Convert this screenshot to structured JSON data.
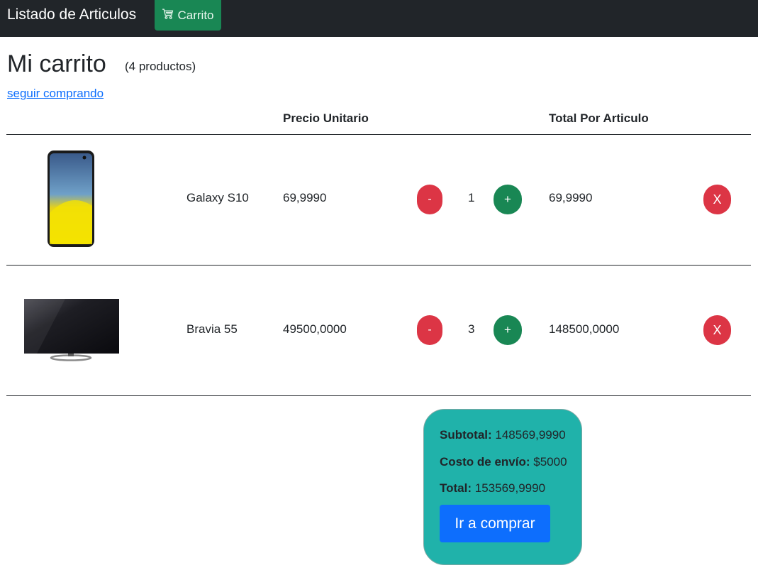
{
  "navbar": {
    "brand": "Listado de Articulos",
    "cart_label": "Carrito",
    "cart_icon": "cart-icon"
  },
  "page": {
    "title": "Mi carrito",
    "count": "(4 productos)",
    "continue_link": "seguir comprando"
  },
  "table": {
    "headers": [
      "Precio Unitario",
      "Total Por Articulo"
    ],
    "rows": [
      {
        "name": "Galaxy S10",
        "price": "69,9990",
        "qty": "1",
        "total": "69,9990",
        "minus": "-",
        "plus": "+",
        "remove": "X",
        "image": "phone-image"
      },
      {
        "name": "Bravia 55",
        "price": "49500,0000",
        "qty": "3",
        "total": "148500,0000",
        "minus": "-",
        "plus": "+",
        "remove": "X",
        "image": "tv-image"
      }
    ]
  },
  "summary": {
    "subtotal_label": "Subtotal:",
    "subtotal_value": "148569,9990",
    "shipping_label": "Costo de envío:",
    "shipping_value": "$5000",
    "total_label": "Total:",
    "total_value": "153569,9990",
    "buy_label": "Ir a comprar"
  },
  "colors": {
    "navbar_bg": "#212529",
    "success": "#198754",
    "danger": "#dc3545",
    "primary": "#0d6efd",
    "summary_bg": "#20b2aa"
  }
}
